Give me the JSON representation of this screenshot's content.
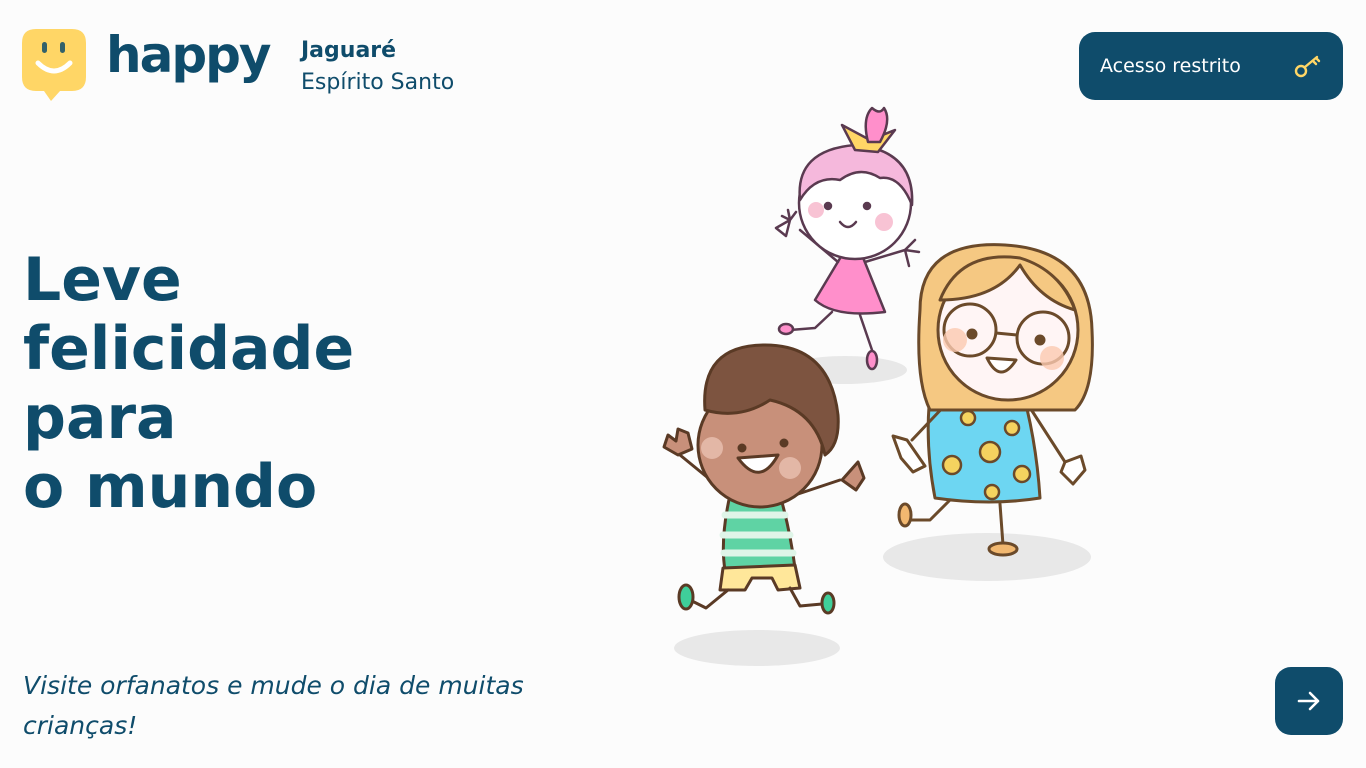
{
  "header": {
    "brand": "happy",
    "location": {
      "city": "Jaguaré",
      "state": "Espírito Santo"
    },
    "access_button": {
      "label": "Acesso restrito",
      "icon": "key-icon"
    }
  },
  "hero": {
    "headline": [
      "Leve",
      "felicidade",
      "para",
      "o mundo"
    ],
    "tagline": "Visite orfanatos e mude o dia de muitas crianças!"
  },
  "next_button": {
    "icon": "arrow-right-icon"
  },
  "colors": {
    "primary": "#0f4c6b",
    "logo": "#ffd666",
    "key": "#ffd666"
  }
}
